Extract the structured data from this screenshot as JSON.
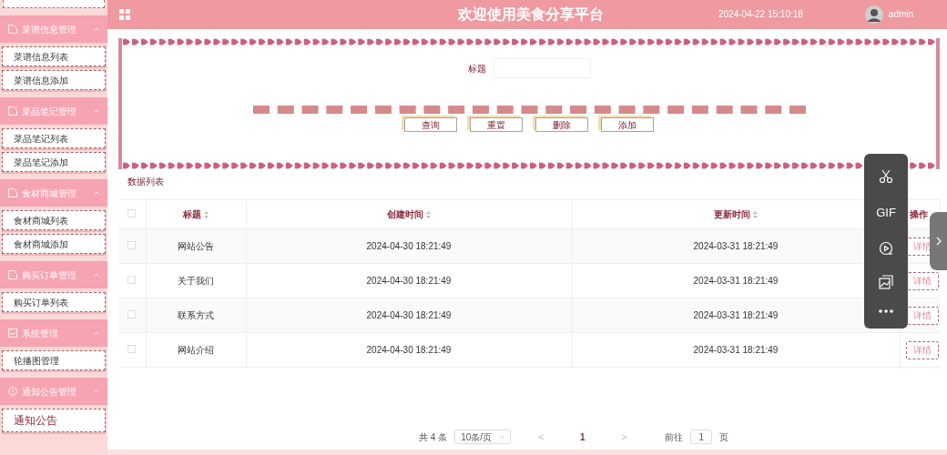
{
  "header": {
    "title": "欢迎使用美食分享平台",
    "datetime": "2024-04-22 15:10:18",
    "user": "admin"
  },
  "sidebar": {
    "groups": [
      {
        "label": "菜谱信息管理",
        "kind": "doc",
        "expanded": true,
        "items": [
          {
            "label": "菜谱信息列表",
            "selected": false
          },
          {
            "label": "菜谱信息添加",
            "selected": false
          }
        ]
      },
      {
        "label": "菜品笔记管理",
        "kind": "doc",
        "expanded": true,
        "items": [
          {
            "label": "菜品笔记列表",
            "selected": false
          },
          {
            "label": "菜品笔记添加",
            "selected": false
          }
        ]
      },
      {
        "label": "食材商城管理",
        "kind": "doc",
        "expanded": true,
        "items": [
          {
            "label": "食材商城列表",
            "selected": false
          },
          {
            "label": "食材商城添加",
            "selected": false
          }
        ]
      },
      {
        "label": "购买订单管理",
        "kind": "doc",
        "expanded": true,
        "items": [
          {
            "label": "购买订单列表",
            "selected": false
          }
        ]
      },
      {
        "label": "系统管理",
        "kind": "chart",
        "expanded": true,
        "items": [
          {
            "label": "轮播图管理",
            "selected": false
          }
        ]
      },
      {
        "label": "通知公告管理",
        "kind": "info",
        "expanded": true,
        "items": [
          {
            "label": "通知公告",
            "selected": true
          }
        ]
      }
    ]
  },
  "search": {
    "label": "标题",
    "buttons": [
      "查询",
      "重置",
      "删除",
      "添加"
    ]
  },
  "table": {
    "caption": "数据列表",
    "all_checked": false,
    "columns": [
      "标题",
      "创建时间",
      "更新时间",
      "操作"
    ],
    "rows": [
      {
        "checked": false,
        "title": "网站公告",
        "created": "2024-04-30 18:21:49",
        "updated": "2024-03-31 18:21:49",
        "action": "详情"
      },
      {
        "checked": false,
        "title": "关于我们",
        "created": "2024-04-30 18:21:49",
        "updated": "2024-03-31 18:21:49",
        "action": "详情"
      },
      {
        "checked": false,
        "title": "联系方式",
        "created": "2024-04-30 18:21:49",
        "updated": "2024-03-31 18:21:49",
        "action": "详情"
      },
      {
        "checked": false,
        "title": "网站介绍",
        "created": "2024-04-30 18:21:49",
        "updated": "2024-03-31 18:21:49",
        "action": "详情"
      }
    ]
  },
  "pagination": {
    "total": "共 4 条",
    "page_size": "10条/页",
    "prev": "<",
    "page": "1",
    "next": ">",
    "goto": "前往",
    "goto_value": "1",
    "page_unit": "页"
  },
  "toolbar": {
    "gif_label": "GIF"
  }
}
